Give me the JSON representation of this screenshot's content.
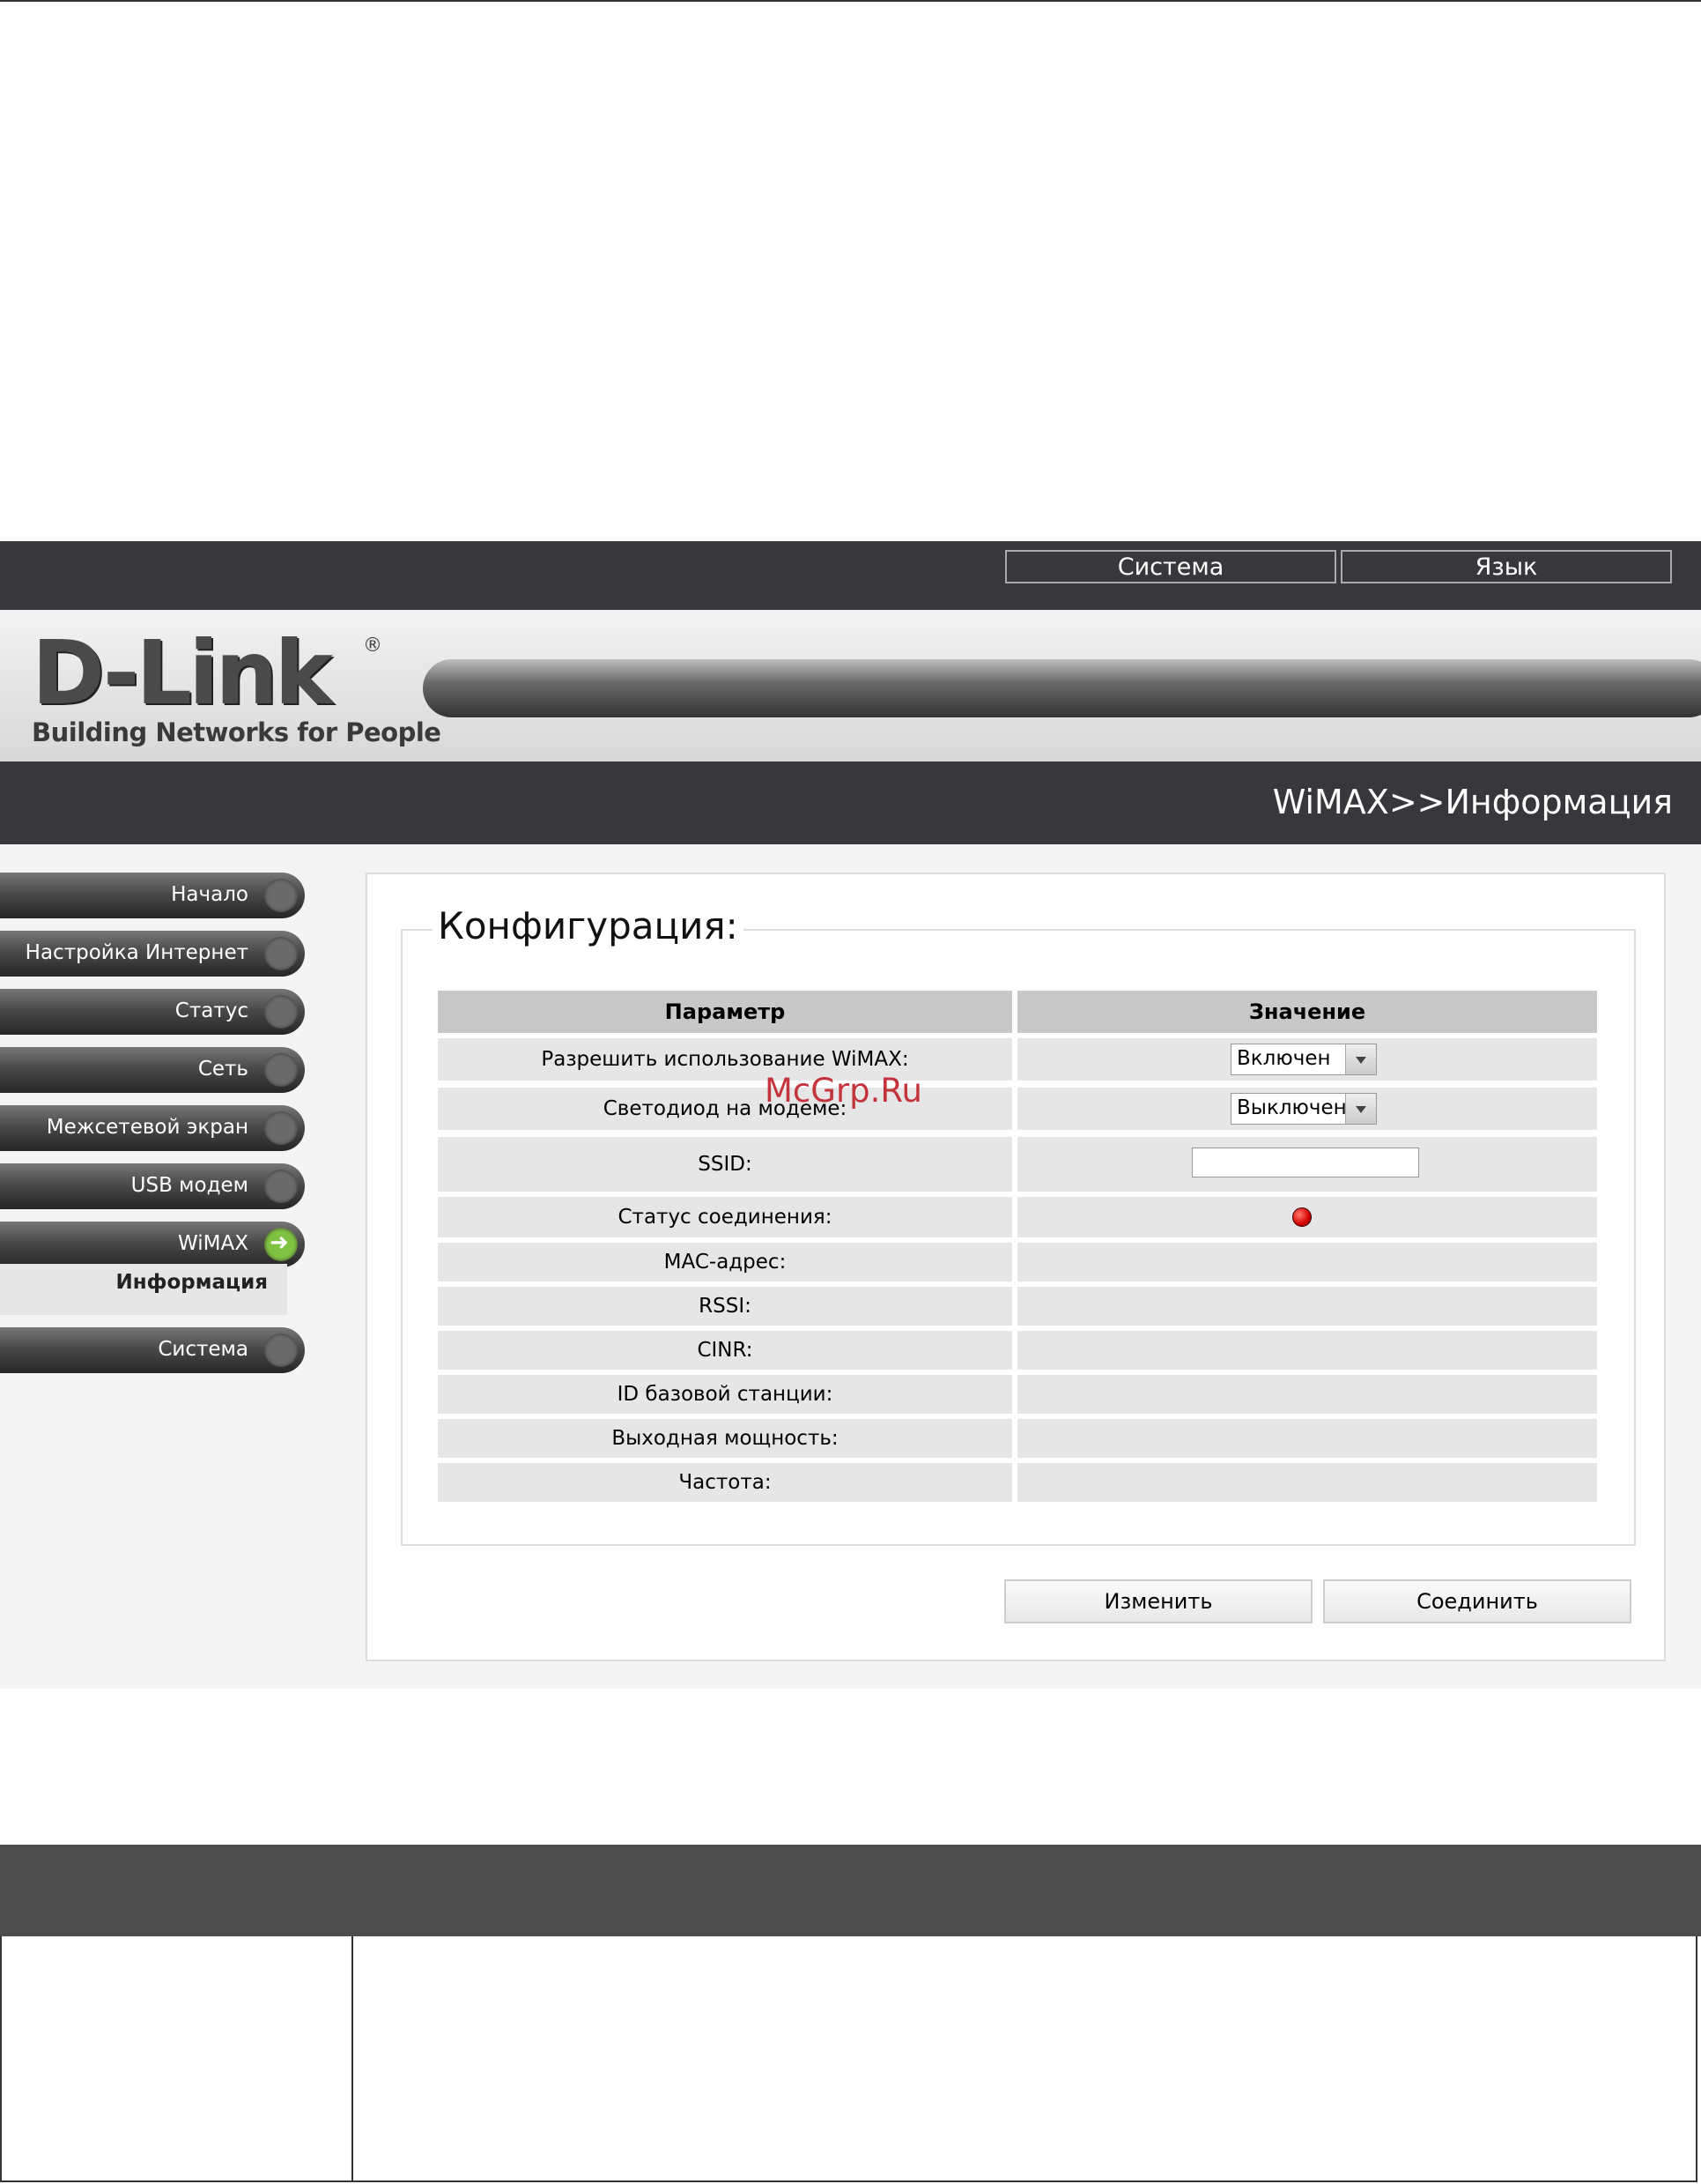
{
  "topbar": {
    "system_label": "Система",
    "language_label": "Язык"
  },
  "logo": {
    "brand": "D-Link",
    "registered": "®",
    "tagline": "Building Networks for People"
  },
  "breadcrumb": "WiMAX>>Информация",
  "sidebar": {
    "items": [
      {
        "label": "Начало"
      },
      {
        "label": "Настройка Интернет"
      },
      {
        "label": "Статус"
      },
      {
        "label": "Сеть"
      },
      {
        "label": "Межсетевой экран"
      },
      {
        "label": "USB модем"
      },
      {
        "label": "WiMAX"
      },
      {
        "label": "Система"
      }
    ],
    "submenu_active": "Информация"
  },
  "config": {
    "legend": "Конфигурация:",
    "header_param": "Параметр",
    "header_value": "Значение",
    "rows": [
      {
        "param": "Разрешить использование WiMAX:",
        "value": "Включен"
      },
      {
        "param": "Светодиод на модеме:",
        "value": "Выключен"
      },
      {
        "param": "SSID:",
        "value": ""
      },
      {
        "param": "Статус соединения:"
      },
      {
        "param": "MAC-адрес:"
      },
      {
        "param": "RSSI:"
      },
      {
        "param": "CINR:"
      },
      {
        "param": "ID базовой станции:"
      },
      {
        "param": "Выходная мощность:"
      },
      {
        "param": "Частота:"
      }
    ],
    "connection_status_color": "#d40000"
  },
  "actions": {
    "change_label": "Изменить",
    "connect_label": "Соединить"
  },
  "watermark": "McGrp.Ru"
}
